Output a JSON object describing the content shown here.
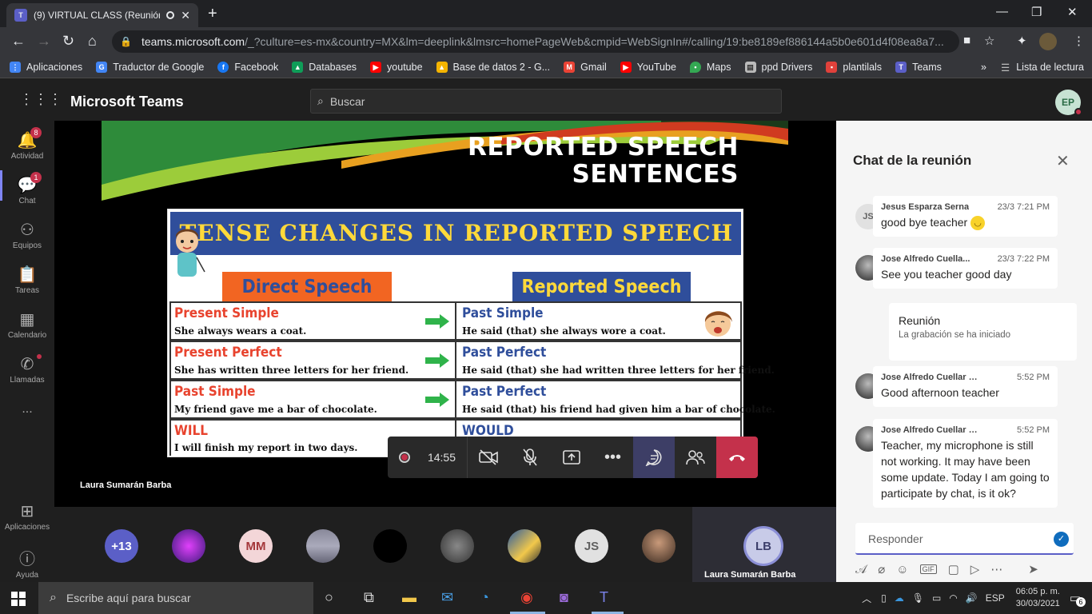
{
  "browser": {
    "tab_title": "(9) VIRTUAL CLASS (Reunión)",
    "tab_favicon": "teams-icon",
    "url_host": "teams.microsoft.com",
    "url_rest": "/_?culture=es-mx&country=MX&lm=deeplink&lmsrc=homePageWeb&cmpid=WebSignIn#/calling/19:be8189ef886144a5b0e601d4f08ea8a7...",
    "bookmarks": [
      {
        "label": "Aplicaciones",
        "icon": "apps-grid-icon",
        "color": "#4285f4"
      },
      {
        "label": "Traductor de Google",
        "icon": "translate-icon",
        "color": "#4285f4"
      },
      {
        "label": "Facebook",
        "icon": "facebook-icon",
        "color": "#1877f2"
      },
      {
        "label": "Databases",
        "icon": "drive-icon",
        "color": "#0f9d58"
      },
      {
        "label": "youtube",
        "icon": "youtube-icon",
        "color": "#ff0000"
      },
      {
        "label": "Base de datos 2 - G...",
        "icon": "drive-icon",
        "color": "#f4b400"
      },
      {
        "label": "Gmail",
        "icon": "gmail-icon",
        "color": "#ea4335"
      },
      {
        "label": "YouTube",
        "icon": "youtube-icon",
        "color": "#ff0000"
      },
      {
        "label": "Maps",
        "icon": "maps-pin-icon",
        "color": "#34a853"
      },
      {
        "label": "ppd Drivers",
        "icon": "printer-icon",
        "color": "#bbbbbb"
      },
      {
        "label": "plantilals",
        "icon": "bookmark-red-icon",
        "color": "#e0413b"
      },
      {
        "label": "Teams",
        "icon": "teams-icon",
        "color": "#5b5fc7"
      }
    ],
    "reading_list": "Lista de lectura"
  },
  "teams": {
    "app_name": "Microsoft Teams",
    "search_placeholder": "Buscar",
    "user_initials": "EP",
    "rail": [
      {
        "label": "Actividad",
        "icon": "bell-icon",
        "badge": "8"
      },
      {
        "label": "Chat",
        "icon": "chat-icon",
        "badge": "1"
      },
      {
        "label": "Equipos",
        "icon": "teams-people-icon",
        "badge": ""
      },
      {
        "label": "Tareas",
        "icon": "clipboard-icon",
        "badge": ""
      },
      {
        "label": "Calendario",
        "icon": "calendar-icon",
        "badge": ""
      },
      {
        "label": "Llamadas",
        "icon": "phone-icon",
        "badge": ""
      }
    ],
    "rail_more": "...",
    "rail_bottom": [
      {
        "label": "Aplicaciones",
        "icon": "apps-icon"
      },
      {
        "label": "Ayuda",
        "icon": "help-icon"
      }
    ]
  },
  "slide": {
    "title_line1": "REPORTED SPEECH",
    "title_line2": "SENTENCES",
    "banner": "TENSE CHANGES IN REPORTED SPEECH",
    "header_direct": "Direct Speech",
    "header_reported": "Reported Speech",
    "rows": [
      {
        "direct_tense": "Present Simple",
        "direct_example": "She always wears a coat.",
        "reported_tense": "Past Simple",
        "reported_example": "He said (that) she always wore a coat."
      },
      {
        "direct_tense": "Present Perfect",
        "direct_example": "She has written three letters for her friend.",
        "reported_tense": "Past Perfect",
        "reported_example": "He said (that) she had written three letters for her friend."
      },
      {
        "direct_tense": "Past Simple",
        "direct_example": "My friend gave me a bar of chocolate.",
        "reported_tense": "Past Perfect",
        "reported_example": "He said (that) his friend had given him a bar of chocolate."
      },
      {
        "direct_tense": "WILL",
        "direct_example": "I will finish my report in two days.",
        "reported_tense": "WOULD",
        "reported_example": ""
      }
    ]
  },
  "presenter_name": "Laura Sumarán Barba",
  "call": {
    "timer": "14:55",
    "buttons": [
      "record-icon",
      "camera-off-icon",
      "mic-off-icon",
      "share-screen-icon",
      "more-icon",
      "chat-icon",
      "participants-icon",
      "hangup-icon"
    ]
  },
  "participants": {
    "overflow": "+13",
    "tiles": [
      {
        "kind": "image",
        "color": "#6a3fb0"
      },
      {
        "kind": "initials",
        "text": "MM",
        "bg": "#f3d6d8",
        "fg": "#a4373a"
      },
      {
        "kind": "image",
        "color": "#7a8a7a"
      },
      {
        "kind": "image",
        "color": "#000000"
      },
      {
        "kind": "image",
        "color": "#5a5a5a"
      },
      {
        "kind": "image",
        "color": "#d8b050"
      },
      {
        "kind": "initials",
        "text": "JS",
        "bg": "#e1e1e1",
        "fg": "#616161"
      },
      {
        "kind": "image",
        "color": "#8a6a50"
      }
    ],
    "active_speaker_initials": "LB",
    "active_speaker_name": "Laura Sumarán Barba"
  },
  "chat": {
    "title": "Chat de la reunión",
    "messages": [
      {
        "sender": "Jesus Esparza Serna",
        "time": "23/3 7:21 PM",
        "text": "good bye teacher",
        "avatar": "JS",
        "emoji": "smile-emoji-icon"
      },
      {
        "sender": "Jose Alfredo Cuella...",
        "time": "23/3 7:22 PM",
        "text": "See you teacher good day",
        "avatar": "photo"
      },
      {
        "sender": "Jose Alfredo Cuellar Gov...",
        "time": "5:52 PM",
        "text": "Good afternoon teacher",
        "avatar": "photo"
      },
      {
        "sender": "Jose Alfredo Cuellar Gov...",
        "time": "5:52 PM",
        "text": "Teacher, my microphone is still not working. It may have been some update. Today I am going to participate by chat, is it ok?",
        "avatar": "photo"
      }
    ],
    "system_title": "Reunión",
    "system_text": "La grabación se ha iniciado",
    "compose_placeholder": "Responder",
    "tools": [
      "format-icon",
      "attach-icon",
      "emoji-icon",
      "gif-icon",
      "sticker-icon",
      "meet-now-icon",
      "more-icon"
    ]
  },
  "taskbar": {
    "search_placeholder": "Escribe aquí para buscar",
    "lang": "ESP",
    "time": "06:05 p. m.",
    "date": "30/03/2021",
    "notifications": "6"
  }
}
